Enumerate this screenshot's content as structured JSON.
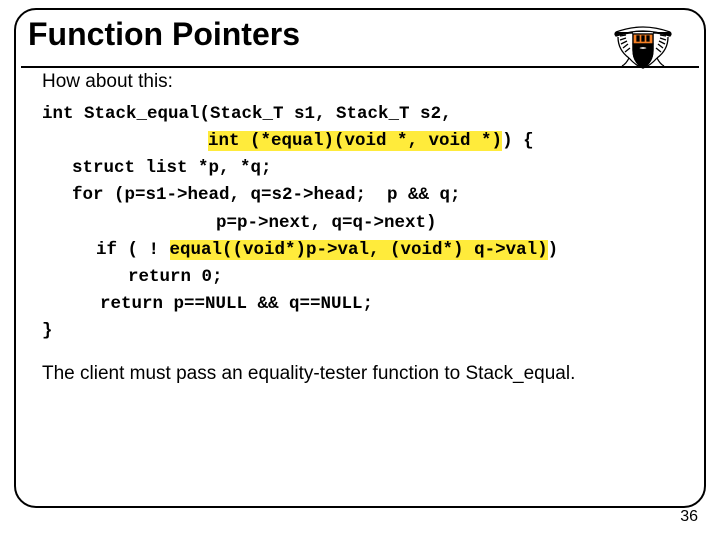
{
  "title": "Function Pointers",
  "intro": "How about this:",
  "code": {
    "l1a": "int Stack_equal(Stack_T s1, Stack_T s2,",
    "l2h": "int (*equal)(void *, void *)",
    "l2b": ") {",
    "l3": "struct list *p, *q;",
    "l4": "for (p=s1->head, q=s2->head;  p && q;",
    "l5": "p=p->next, q=q->next)",
    "l6a": "if ( ! ",
    "l6h": "equal((void*)p->val, (void*) q->val)",
    "l6b": ")",
    "l7": "return 0;",
    "l8": "return p==NULL && q==NULL;",
    "l9": "}"
  },
  "footnote": "The client must pass an equality-tester function to Stack_equal.",
  "pagenum": "36"
}
